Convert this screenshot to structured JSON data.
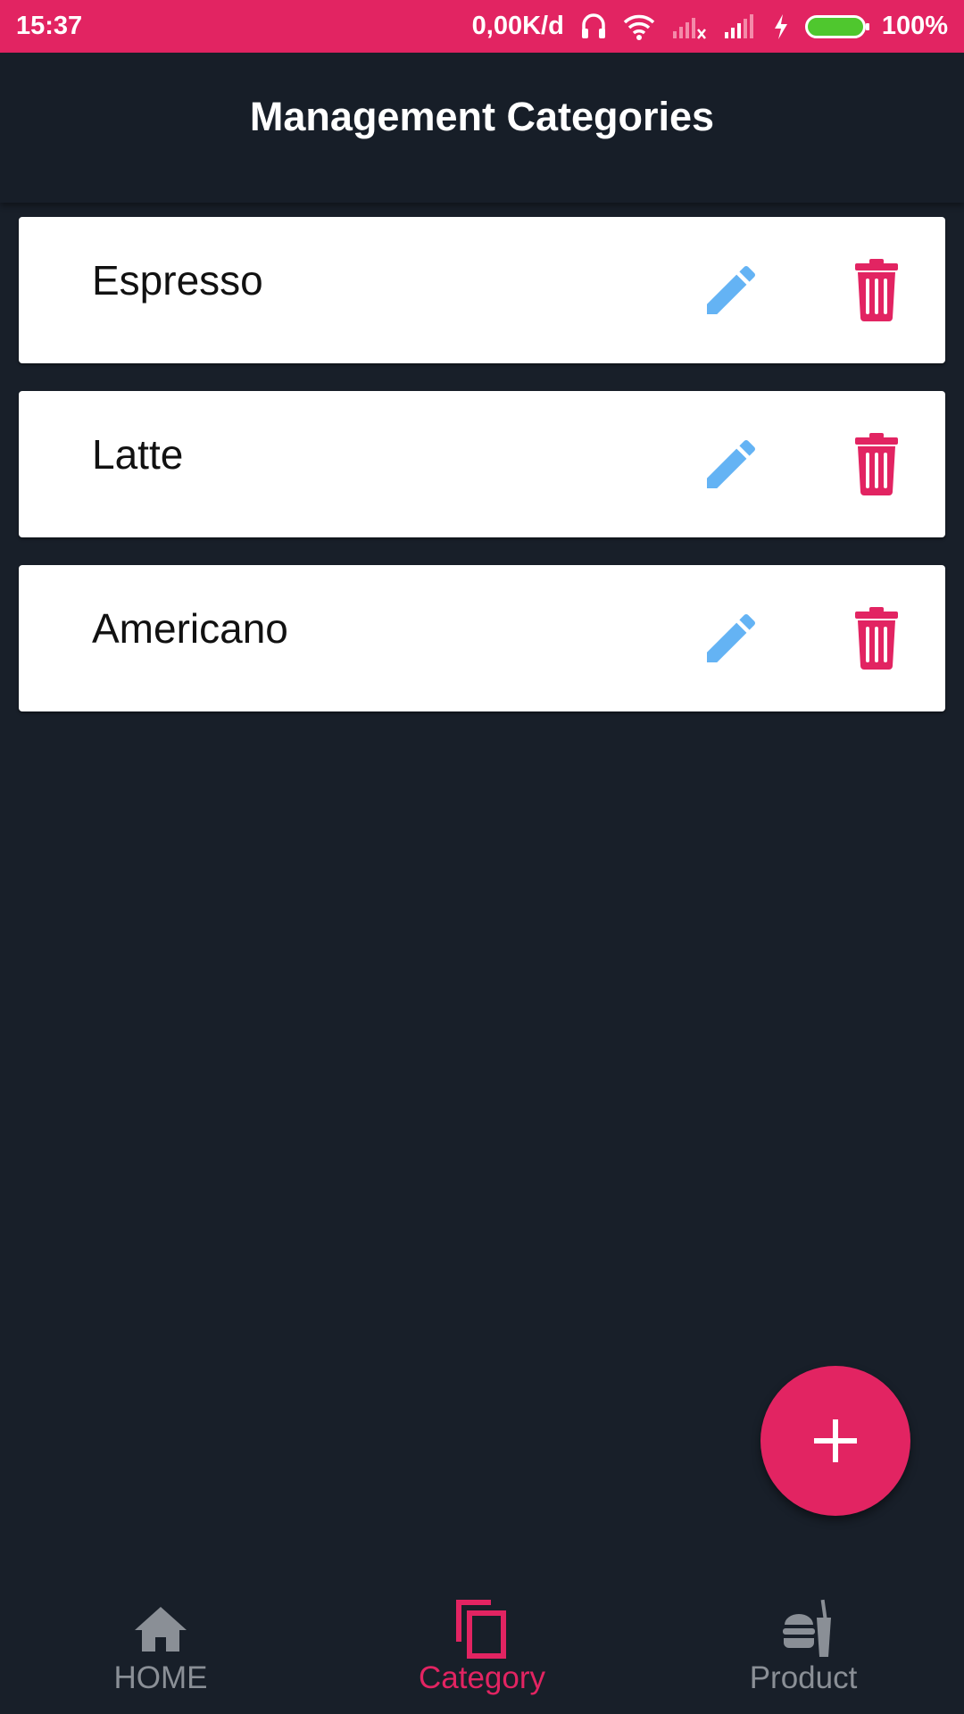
{
  "status_bar": {
    "time": "15:37",
    "net_speed": "0,00K/d",
    "battery_pct": "100%",
    "icons": [
      "headset-icon",
      "wifi-icon",
      "signal-no-sim-icon",
      "signal-icon",
      "charging-icon",
      "battery-icon"
    ],
    "background_color": "#e22462"
  },
  "app_bar": {
    "title": "Management Categories"
  },
  "categories": [
    {
      "label": "Espresso"
    },
    {
      "label": "Latte"
    },
    {
      "label": "Americano"
    }
  ],
  "actions": {
    "edit_icon": "pencil-icon",
    "delete_icon": "trash-icon",
    "edit_color": "#64b3f4",
    "delete_color": "#e22462"
  },
  "fab": {
    "icon": "plus-icon",
    "color": "#e22462"
  },
  "bottom_nav": {
    "items": [
      {
        "label": "HOME",
        "icon": "home-icon",
        "active": false
      },
      {
        "label": "Category",
        "icon": "copy-icon",
        "active": true
      },
      {
        "label": "Product",
        "icon": "fast-food-icon",
        "active": false
      }
    ],
    "active_color": "#e22462",
    "inactive_color": "#8a8f96"
  }
}
